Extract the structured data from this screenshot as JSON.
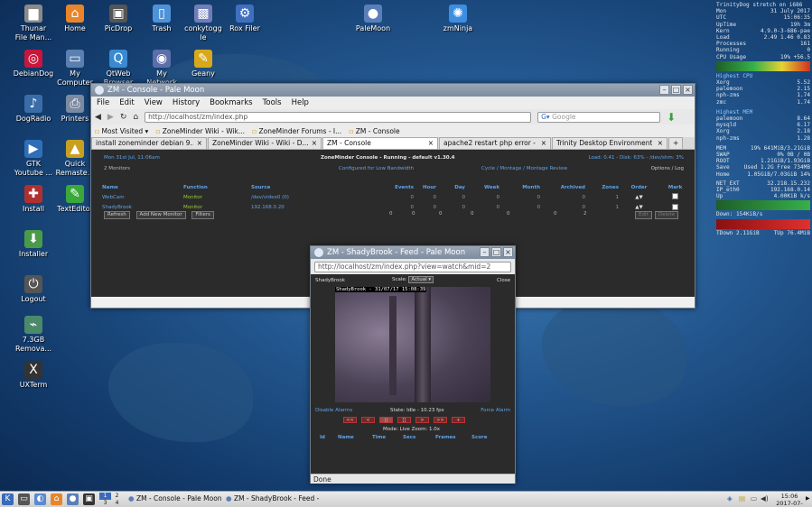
{
  "desktop": {
    "icons": [
      {
        "id": "thunar",
        "label": "Thunar\nFile Man...",
        "glyph": "▆",
        "color": "#8a8a8a"
      },
      {
        "id": "home",
        "label": "Home",
        "glyph": "⌂",
        "color": "#e8842a"
      },
      {
        "id": "picdrop",
        "label": "PicDrop",
        "glyph": "▣",
        "color": "#555"
      },
      {
        "id": "trash",
        "label": "Trash",
        "glyph": "▯",
        "color": "#4e92d8"
      },
      {
        "id": "conkytoggle",
        "label": "conkytogg\nle",
        "glyph": "▩",
        "color": "#6f7db8"
      },
      {
        "id": "roxfiler",
        "label": "Rox Filer",
        "glyph": "⚙",
        "color": "#3f70c0"
      },
      {
        "id": "palemoon",
        "label": "PaleMoon",
        "glyph": "●",
        "color": "#5a7fb8"
      },
      {
        "id": "zmninja",
        "label": "zmNinja",
        "glyph": "✺",
        "color": "#3d8de0"
      },
      {
        "id": "debiandog",
        "label": "DebianDog",
        "glyph": "◎",
        "color": "#c8163c"
      },
      {
        "id": "mycomputer",
        "label": "My\nComputer",
        "glyph": "▭",
        "color": "#5b7fb0"
      },
      {
        "id": "qtweb",
        "label": "QtWeb\nBrowser",
        "glyph": "Q",
        "color": "#3a8ad0"
      },
      {
        "id": "mynetwork",
        "label": "My\nNetwork",
        "glyph": "◉",
        "color": "#5d6ea8"
      },
      {
        "id": "geany",
        "label": "Geany",
        "glyph": "✎",
        "color": "#d8a81a"
      },
      {
        "id": "dogradio",
        "label": "DogRadio",
        "glyph": "♪",
        "color": "#3a6ca8"
      },
      {
        "id": "printers",
        "label": "Printers",
        "glyph": "⎙",
        "color": "#7a8aa0"
      },
      {
        "id": "gtkyoutube",
        "label": "GTK\nYoutube ...",
        "glyph": "▶",
        "color": "#2f6fb8"
      },
      {
        "id": "quickremaster",
        "label": "Quick\nRemaste...",
        "glyph": "▲",
        "color": "#c8a020"
      },
      {
        "id": "install",
        "label": "Install",
        "glyph": "✚",
        "color": "#b03030"
      },
      {
        "id": "texteditor",
        "label": "TextEditor",
        "glyph": "✎",
        "color": "#3aa83a"
      },
      {
        "id": "installer",
        "label": "Installer",
        "glyph": "⬇",
        "color": "#4a9a4a"
      },
      {
        "id": "logout",
        "label": "Logout",
        "glyph": "⏻",
        "color": "#555"
      },
      {
        "id": "removable",
        "label": "7.3GB\nRemova...",
        "glyph": "⌁",
        "color": "#4a8a6a"
      },
      {
        "id": "uxterm",
        "label": "UXTerm",
        "glyph": "X",
        "color": "#333"
      }
    ]
  },
  "conky": {
    "header": "TrinityDog stretch on i686",
    "lines": [
      [
        "Mon",
        "31 July 2017"
      ],
      [
        "UTC",
        "15:06:35"
      ],
      [
        "UpTime",
        "19h 3m"
      ],
      [
        "Kern",
        "4.9.0-3-686-pae"
      ],
      [
        "Load",
        "2.49 1.46 0.83"
      ],
      [
        "Processes",
        "161"
      ],
      [
        "Running",
        "0"
      ],
      [
        "CPU Usage",
        "19%      +56.5"
      ]
    ],
    "cpu_head": "Highest CPU",
    "cpu": [
      [
        "Xorg",
        "5.52"
      ],
      [
        "palemoon",
        "2.15"
      ],
      [
        "nph-zms",
        "1.74"
      ],
      [
        "zmc",
        "1.74"
      ]
    ],
    "mem_head": "Highest MEM",
    "mem": [
      [
        "palemoon",
        "8.64"
      ],
      [
        "mysqld",
        "6.17"
      ],
      [
        "Xorg",
        "2.18"
      ],
      [
        "nph-zms",
        "1.28"
      ]
    ],
    "stats": [
      [
        "MEM",
        "19% 641MiB/3.21GiB"
      ],
      [
        "SWAP",
        "0% 0B / 0B"
      ],
      [
        "ROOT",
        "1.21GiB/1.93GiB"
      ],
      [
        "Save",
        "Used 1.2G Free 734MB"
      ],
      [
        "Home",
        "1.05GiB/7.03GiB 14%"
      ]
    ],
    "net": [
      [
        "NET_EXT",
        "32.218.15.232"
      ],
      [
        "IP_eth0",
        "192.168.0.14"
      ],
      [
        "Up",
        "4.00KiB k/s"
      ]
    ],
    "down": "Down: 154KiB/s",
    "totals": [
      "TDown 2.11GiB",
      "TUp 76.4MiB"
    ]
  },
  "console_window": {
    "title": "ZM - Console - Pale Moon",
    "menu": [
      "File",
      "Edit",
      "View",
      "History",
      "Bookmarks",
      "Tools",
      "Help"
    ],
    "url": "http://localhost/zm/index.php",
    "search_placeholder": "Google",
    "bookmarks": [
      "Most Visited ▾",
      "ZoneMinder Wiki - Wik...",
      "ZoneMinder Forums - I...",
      "ZM - Console"
    ],
    "tabs": [
      {
        "label": "install zoneminder debian 9...",
        "active": false
      },
      {
        "label": "ZoneMinder Wiki - Wiki - D...",
        "active": false
      },
      {
        "label": "ZM - Console",
        "active": true
      },
      {
        "label": "apache2 restart php error - ...",
        "active": false
      },
      {
        "label": "Trinity Desktop Environment",
        "active": false
      }
    ],
    "zm": {
      "date": "Mon 31st Jul, 11:06am",
      "status": "ZoneMinder Console - Running - default v1.30.4",
      "load": "Load: 0.41 - Disk: 63% - /dev/shm: 3%",
      "monitors_count": "2 Monitors",
      "bandwidth": "Configured for Low Bandwidth",
      "links": "Cycle / Montage / Montage Review",
      "options": "Options / Log",
      "columns": [
        "Name",
        "Function",
        "Source",
        "Events",
        "Hour",
        "Day",
        "Week",
        "Month",
        "Archived",
        "Zones",
        "Order",
        "Mark"
      ],
      "rows": [
        [
          "WebCam",
          "Monitor",
          "/dev/video0 (0)",
          "0",
          "0",
          "0",
          "0",
          "0",
          "0",
          "1",
          "▲▼",
          ""
        ],
        [
          "ShadyBrook",
          "Monitor",
          "192.168.0.20",
          "0",
          "0",
          "0",
          "0",
          "0",
          "0",
          "1",
          "▲▼",
          ""
        ]
      ],
      "totals": [
        "0",
        "0",
        "0",
        "0",
        "0",
        "0",
        "2"
      ],
      "buttons": [
        "Refresh",
        "Add New Monitor",
        "Filters"
      ],
      "edit": "Edit",
      "delete": "Delete"
    }
  },
  "feed_window": {
    "title": "ZM - ShadyBrook - Feed - Pale Moon",
    "url": "http://localhost/zm/index.php?view=watch&mid=2",
    "monitor": "ShadyBrook",
    "scale_label": "Scale:",
    "scale": "Actual",
    "close": "Close",
    "timestamp": "ShadyBrook - 31/07/17 15:08:39",
    "disable_alarms": "Disable Alarms",
    "state": "State: Idle - 10.23 fps",
    "force_alarm": "Force Alarm",
    "controls": [
      "<<",
      "<",
      "||",
      "[]",
      ">",
      ">>",
      "+"
    ],
    "mode": "Mode: Live   Zoom: 1.0x",
    "columns": [
      "Id",
      "Name",
      "Time",
      "Secs",
      "Frames",
      "Score"
    ],
    "status": "Done"
  },
  "taskbar": {
    "desktops": [
      "1",
      "2",
      "3",
      "4"
    ],
    "tasks": [
      "ZM - Console - Pale Moon",
      "ZM - ShadyBrook - Feed -"
    ],
    "time": "15:06",
    "date": "2017-07-31"
  }
}
